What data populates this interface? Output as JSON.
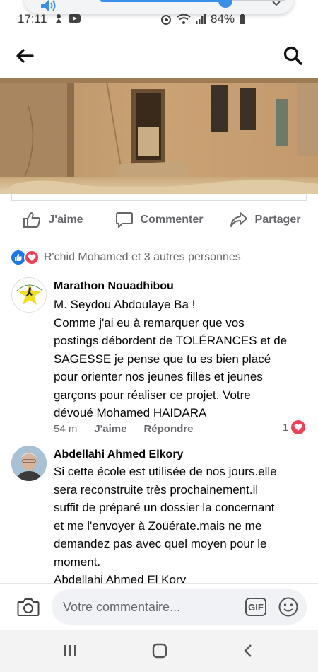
{
  "status_bar": {
    "time": "17:11",
    "battery": "84%"
  },
  "actions": {
    "like": "J'aime",
    "comment": "Commenter",
    "share": "Partager"
  },
  "reactions": {
    "summary": "R'chid Mohamed et 3 autres personnes"
  },
  "comments": [
    {
      "author": "Marathon Nouadhibou",
      "avatar_text_top": "MARATHON INTERNATIONAL",
      "avatar_text_bottom": "DE NOUADHIBOU",
      "lines": [
        "M. Seydou Abdoulaye Ba !",
        "Comme j'ai eu à remarquer que vos",
        "postings débordent de TOLÉRANCES et de",
        "SAGESSE je pense que tu es bien placé",
        "pour orienter nos jeunes filles et jeunes",
        "garçons pour réaliser ce projet. Votre",
        "dévoué Mohamed HAIDARA"
      ],
      "time": "54 m",
      "like": "J'aime",
      "reply": "Répondre",
      "reaction_count": "1"
    },
    {
      "author": "Abdellahi Ahmed Elkory",
      "lines": [
        "Si cette école est utilisée de nos jours.elle",
        "sera reconstruite très prochainement.il",
        "suffit de préparé  un dossier la concernant",
        "et me l'envoyer à Zouérate.mais ne me",
        "demandez pas avec quel moyen pour le",
        "moment.",
        "Abdellahi Ahmed El Kory"
      ]
    }
  ],
  "composer": {
    "placeholder": "Votre commentaire...",
    "gif": "GIF"
  },
  "colors": {
    "accent": "#1877f2",
    "love": "#f33e58",
    "muted": "#65676b"
  },
  "icons": [
    "back-arrow-icon",
    "search-icon",
    "like-icon",
    "comment-icon",
    "share-icon",
    "camera-icon",
    "gif-icon",
    "emoji-icon",
    "recents-icon",
    "home-icon",
    "back-icon"
  ]
}
